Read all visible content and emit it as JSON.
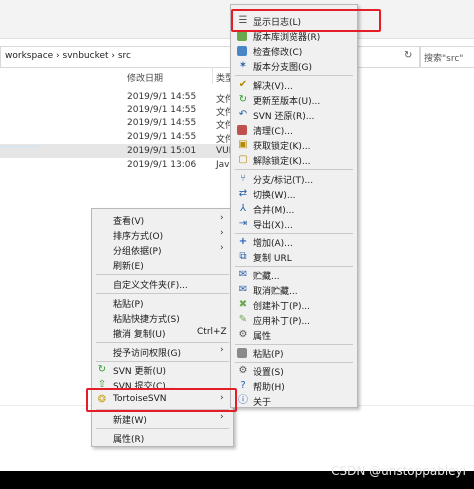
{
  "explorer": {
    "breadcrumb": "workspace  ›  svnbucket  ›  src",
    "search_placeholder": "搜索\"src\"",
    "columns": {
      "date": "修改日期",
      "type": "类型"
    },
    "rows": [
      {
        "date": "2019/9/1 14:55",
        "type": "文件"
      },
      {
        "date": "2019/9/1 14:55",
        "type": "文件"
      },
      {
        "date": "2019/9/1 14:55",
        "type": "文件"
      },
      {
        "date": "2019/9/1 14:55",
        "type": "文件"
      },
      {
        "date": "2019/9/1 15:01",
        "type": "VUE"
      },
      {
        "date": "2019/9/1 13:06",
        "type": "Java"
      }
    ]
  },
  "context_menu": {
    "items": [
      {
        "label": "查看(V)"
      },
      {
        "label": "排序方式(O)"
      },
      {
        "label": "分组依据(P)"
      },
      {
        "label": "刷新(E)"
      },
      {
        "label": "自定义文件夹(F)..."
      },
      {
        "label": "粘贴(P)"
      },
      {
        "label": "粘贴快捷方式(S)"
      },
      {
        "label": "撤消 复制(U)",
        "shortcut": "Ctrl+Z"
      },
      {
        "label": "授予访问权限(G)"
      },
      {
        "label": "SVN 更新(U)"
      },
      {
        "label": "SVN 提交(C)..."
      },
      {
        "label": "TortoiseSVN"
      },
      {
        "label": "新建(W)"
      },
      {
        "label": "属性(R)"
      }
    ]
  },
  "svn_menu": {
    "items": [
      {
        "label": "显示日志(L)"
      },
      {
        "label": "版本库浏览器(R)"
      },
      {
        "label": "检查修改(C)"
      },
      {
        "label": "版本分支图(G)"
      },
      {
        "label": "解决(V)..."
      },
      {
        "label": "更新至版本(U)..."
      },
      {
        "label": "SVN 还原(R)..."
      },
      {
        "label": "清理(C)..."
      },
      {
        "label": "获取锁定(K)..."
      },
      {
        "label": "解除锁定(K)..."
      },
      {
        "label": "分支/标记(T)..."
      },
      {
        "label": "切换(W)..."
      },
      {
        "label": "合并(M)..."
      },
      {
        "label": "导出(X)..."
      },
      {
        "label": "增加(A)..."
      },
      {
        "label": "复制 URL"
      },
      {
        "label": "贮藏..."
      },
      {
        "label": "取消贮藏..."
      },
      {
        "label": "创建补丁(P)..."
      },
      {
        "label": "应用补丁(P)..."
      },
      {
        "label": "属性"
      },
      {
        "label": "粘贴(P)"
      },
      {
        "label": "设置(S)"
      },
      {
        "label": "帮助(H)"
      },
      {
        "label": "关于"
      }
    ]
  },
  "watermark": "CSDN @unstoppableyi",
  "colors": {
    "highlight_border": "#e41e26",
    "menu_bg": "#f0f0f0"
  }
}
